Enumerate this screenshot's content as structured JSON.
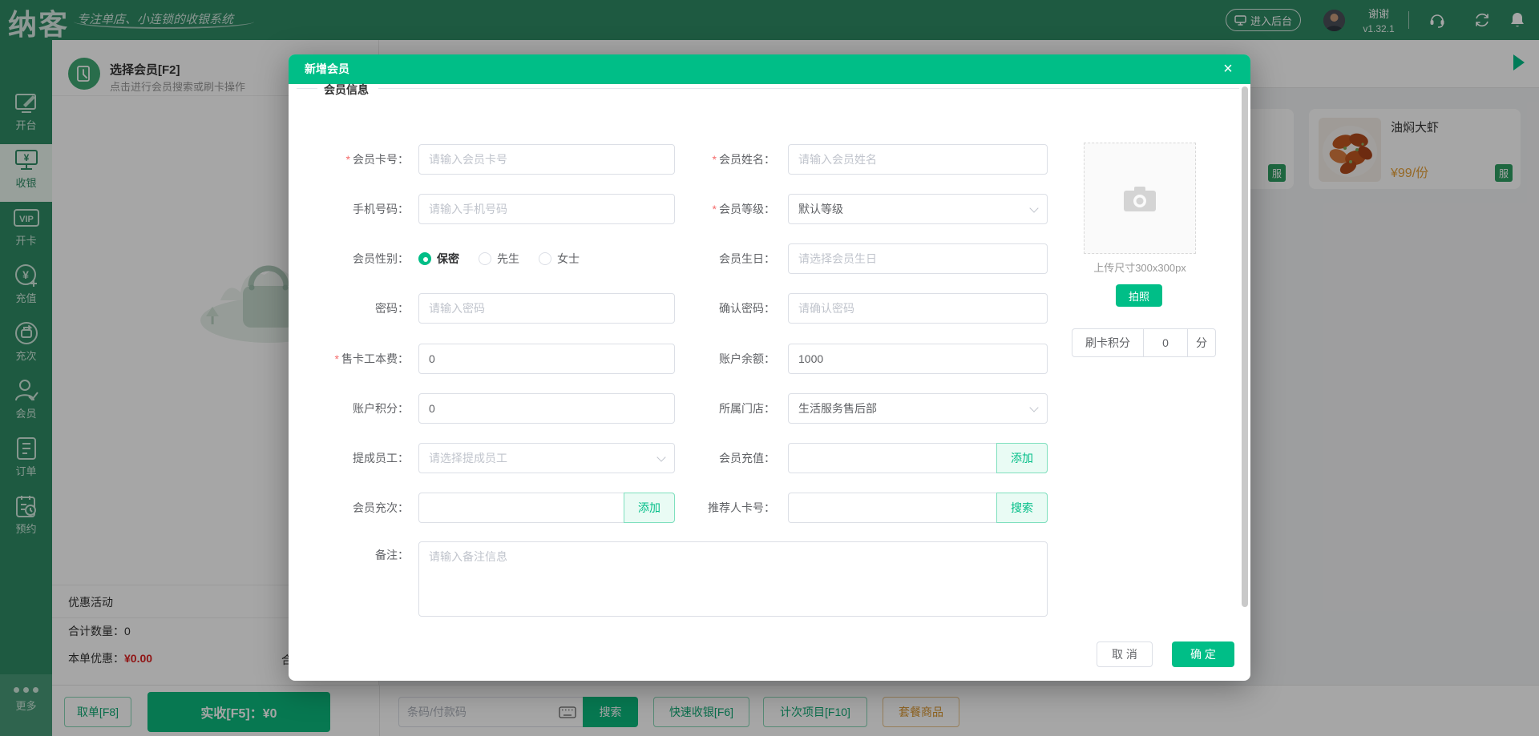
{
  "topbar": {
    "logo": "纳客",
    "tagline": "专注单店、小连锁的收银系统",
    "enter_backend": "进入后台",
    "user_name": "谢谢",
    "version": "v1.32.1"
  },
  "sidebar": {
    "items": [
      {
        "label": "开台"
      },
      {
        "label": "收银"
      },
      {
        "label": "开卡",
        "icon_text": "VIP"
      },
      {
        "label": "充值"
      },
      {
        "label": "充次"
      },
      {
        "label": "会员"
      },
      {
        "label": "订单"
      },
      {
        "label": "预约"
      }
    ],
    "more": "更多"
  },
  "pos": {
    "member_select": {
      "title": "选择会员[F2]",
      "subtitle": "点击进行会员搜索或刷卡操作"
    },
    "promo_title": "优惠活动",
    "total_qty_label": "合计数量：",
    "total_qty": "0",
    "discount_label": "本单优惠：",
    "discount_value": "¥0.00",
    "partial_total_label": "合",
    "hold_button": "取单[F8]",
    "received_button": "实收[F5]：¥0",
    "barcode_placeholder": "条码/付款码",
    "barcode_search": "搜索",
    "quick_cashier": "快速收银[F6]",
    "count_item": "计次项目[F10]",
    "package_goods": "套餐商品",
    "product": {
      "name": "油焖大虾",
      "price": "¥99/份",
      "badge": "服"
    },
    "partial_product_badge": "服"
  },
  "modal": {
    "title": "新增会员",
    "close": "×",
    "section_title": "会员信息",
    "star": "*",
    "fields": {
      "card_no": {
        "label": "会员卡号：",
        "placeholder": "请输入会员卡号",
        "required": true
      },
      "name": {
        "label": "会员姓名：",
        "placeholder": "请输入会员姓名",
        "required": true
      },
      "phone": {
        "label": "手机号码：",
        "placeholder": "请输入手机号码"
      },
      "level": {
        "label": "会员等级：",
        "value": "默认等级",
        "required": true
      },
      "gender": {
        "label": "会员性别：",
        "options": [
          "保密",
          "先生",
          "女士"
        ],
        "selected": "保密"
      },
      "birthday": {
        "label": "会员生日：",
        "placeholder": "请选择会员生日"
      },
      "password": {
        "label": "密码：",
        "placeholder": "请输入密码"
      },
      "confirm_password": {
        "label": "确认密码：",
        "placeholder": "请确认密码"
      },
      "card_fee": {
        "label": "售卡工本费：",
        "value": "0",
        "required": true
      },
      "balance": {
        "label": "账户余额：",
        "value": "1000"
      },
      "points": {
        "label": "账户积分：",
        "value": "0"
      },
      "store": {
        "label": "所属门店：",
        "value": "生活服务售后部"
      },
      "staff": {
        "label": "提成员工：",
        "placeholder": "请选择提成员工"
      },
      "recharge": {
        "label": "会员充值：",
        "button": "添加"
      },
      "times": {
        "label": "会员充次：",
        "button": "添加"
      },
      "referrer": {
        "label": "推荐人卡号：",
        "button": "搜索"
      },
      "remark": {
        "label": "备注：",
        "placeholder": "请输入备注信息"
      }
    },
    "photo": {
      "hint": "上传尺寸300x300px",
      "take_photo": "拍照"
    },
    "swipe_points": {
      "label": "刷卡积分",
      "value": "0",
      "unit": "分"
    },
    "footer": {
      "cancel": "取 消",
      "confirm": "确 定"
    }
  },
  "colors": {
    "brand_green": "#2E8B65",
    "accent_green": "#00BE87",
    "price_orange": "#E6A23C",
    "discount_red": "#DD2222"
  }
}
